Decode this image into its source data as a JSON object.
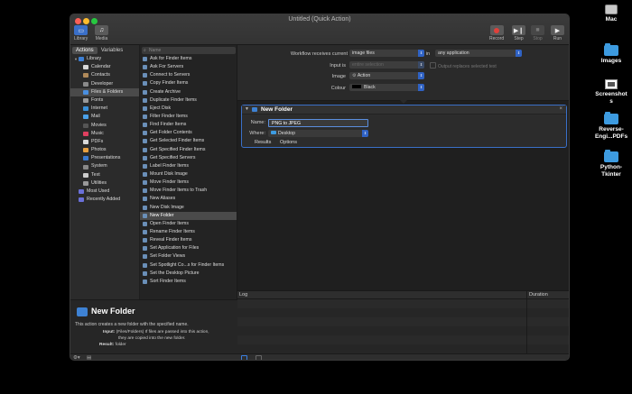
{
  "window": {
    "title": "Untitled (Quick Action)",
    "toolbar": {
      "library": "Library",
      "media": "Media",
      "record": "Record",
      "step": "Step",
      "stop": "Stop",
      "run": "Run"
    }
  },
  "library": {
    "tabs": [
      "Actions",
      "Variables"
    ],
    "items": [
      {
        "label": "Library",
        "icon": "folder-icon",
        "color": "#3d7fd4",
        "level": 0
      },
      {
        "label": "Calendar",
        "icon": "calendar-icon",
        "color": "#d8d8d8",
        "level": 1
      },
      {
        "label": "Contacts",
        "icon": "contacts-icon",
        "color": "#b08a5a",
        "level": 1
      },
      {
        "label": "Developer",
        "icon": "developer-icon",
        "color": "#8a8a8a",
        "level": 1
      },
      {
        "label": "Files & Folders",
        "icon": "finder-icon",
        "color": "#4a8fe0",
        "level": 1,
        "selected": true
      },
      {
        "label": "Fonts",
        "icon": "fonts-icon",
        "color": "#999999",
        "level": 1
      },
      {
        "label": "Internet",
        "icon": "internet-icon",
        "color": "#3a90d8",
        "level": 1
      },
      {
        "label": "Mail",
        "icon": "mail-icon",
        "color": "#4aa0e8",
        "level": 1
      },
      {
        "label": "Movies",
        "icon": "movies-icon",
        "color": "#555555",
        "level": 1
      },
      {
        "label": "Music",
        "icon": "music-icon",
        "color": "#e04060",
        "level": 1
      },
      {
        "label": "PDFs",
        "icon": "pdf-icon",
        "color": "#d8d8d8",
        "level": 1
      },
      {
        "label": "Photos",
        "icon": "photos-icon",
        "color": "#e8a040",
        "level": 1
      },
      {
        "label": "Presentations",
        "icon": "presentations-icon",
        "color": "#3a7ad0",
        "level": 1
      },
      {
        "label": "System",
        "icon": "system-icon",
        "color": "#888888",
        "level": 1
      },
      {
        "label": "Text",
        "icon": "text-icon",
        "color": "#cccccc",
        "level": 1
      },
      {
        "label": "Utilities",
        "icon": "utilities-icon",
        "color": "#999999",
        "level": 1
      },
      {
        "label": "Most Used",
        "icon": "smart-folder-icon",
        "color": "#6a70d8",
        "level": 0
      },
      {
        "label": "Recently Added",
        "icon": "smart-folder-icon",
        "color": "#6a70d8",
        "level": 0
      }
    ]
  },
  "actions": {
    "search_placeholder": "Name",
    "items": [
      "Ask for Finder Items",
      "Ask For Servers",
      "Connect to Servers",
      "Copy Finder Items",
      "Create Archive",
      "Duplicate Finder Items",
      "Eject Disk",
      "Filter Finder Items",
      "Find Finder Items",
      "Get Folder Contents",
      "Get Selected Finder Items",
      "Get Specified Finder Items",
      "Get Specified Servers",
      "Label Finder Items",
      "Mount Disk Image",
      "Move Finder Items",
      "Move Finder Items to Trash",
      "New Aliases",
      "New Disk Image",
      "New Folder",
      "Open Finder Items",
      "Rename Finder Items",
      "Reveal Finder Items",
      "Set Application for Files",
      "Set Folder Views",
      "Set Spotlight Co...s for Finder Items",
      "Set the Desktop Picture",
      "Sort Finder Items"
    ],
    "selected": "New Folder"
  },
  "description": {
    "title": "New Folder",
    "text": "This action creates a new folder with the specified name.",
    "input_label": "Input:",
    "input_text_1": "(Files/Folders) If files are passed into this action,",
    "input_text_2": "they are copied into the new folder.",
    "result_label": "Result:",
    "result_text": "folder"
  },
  "workflow": {
    "receives_label": "Workflow receives current",
    "receives_value": "image files",
    "in_label": "in",
    "in_value": "any application",
    "input_is_label": "Input is",
    "input_is_value": "entire selection",
    "output_replaces": "Output replaces selected text",
    "image_label": "Image",
    "image_value": "Action",
    "colour_label": "Colour",
    "colour_value": "Black"
  },
  "card": {
    "title": "New Folder",
    "name_label": "Name:",
    "name_value": "PNG to JPEG",
    "where_label": "Where:",
    "where_value": "Desktop",
    "results": "Results",
    "options": "Options"
  },
  "log": {
    "col_log": "Log",
    "col_duration": "Duration"
  },
  "desktop": {
    "items": [
      "Mac",
      "Images",
      "Screenshots",
      "Reverse-Engi...PDFs",
      "Python-Tkinter"
    ],
    "screenshots_l1": "Screenshot",
    "screenshots_l2": "s",
    "reverse_l1": "Reverse-",
    "reverse_l2": "Engi...PDFs",
    "python_l1": "Python-",
    "python_l2": "Tkinter"
  }
}
